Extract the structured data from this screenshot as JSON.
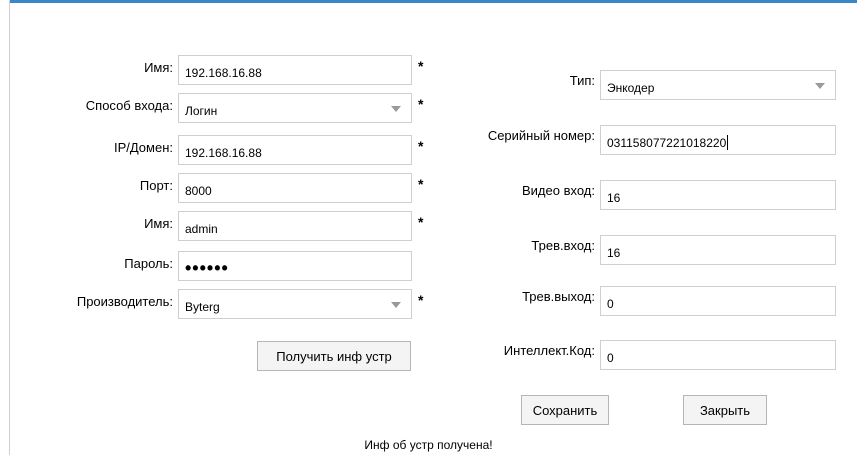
{
  "left": {
    "name": {
      "label": "Имя:",
      "value": "192.168.16.88",
      "required": "*"
    },
    "login_method": {
      "label": "Способ входа:",
      "value": "Логин",
      "required": "*"
    },
    "ip_domain": {
      "label": "IP/Домен:",
      "value": "192.168.16.88",
      "required": "*"
    },
    "port": {
      "label": "Порт:",
      "value": "8000",
      "required": "*"
    },
    "username": {
      "label": "Имя:",
      "value": "admin",
      "required": "*"
    },
    "password": {
      "label": "Пароль:",
      "value": "••••••"
    },
    "manufacturer": {
      "label": "Производитель:",
      "value": "Byterg",
      "required": "*"
    },
    "get_info_button": "Получить инф устр"
  },
  "right": {
    "type": {
      "label": "Тип:",
      "value": "Энкодер"
    },
    "serial": {
      "label": "Серийный номер:",
      "value": "031158077221018220"
    },
    "video_in": {
      "label": "Видео вход:",
      "value": "16"
    },
    "alarm_in": {
      "label": "Трев.вход:",
      "value": "16"
    },
    "alarm_out": {
      "label": "Трев.выход:",
      "value": "0"
    },
    "intellect_code": {
      "label": "Интеллект.Код:",
      "value": "0"
    },
    "save_button": "Сохранить",
    "close_button": "Закрыть"
  },
  "status_text": "Инф об устр  получена!",
  "colors": {
    "accent": "#3a86c8",
    "border": "#cfcfcf"
  }
}
